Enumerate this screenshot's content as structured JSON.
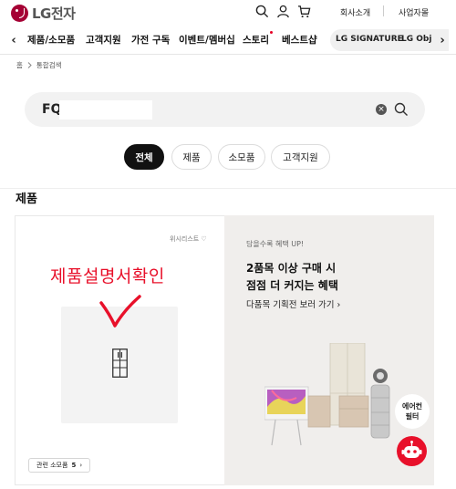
{
  "header": {
    "logo_text": "LG전자",
    "links": [
      "회사소개",
      "사업자몰"
    ]
  },
  "nav": {
    "prev_glyph": "‹",
    "next_glyph": "›",
    "items": [
      {
        "label": "제품/소모품"
      },
      {
        "label": "고객지원"
      },
      {
        "label": "가전 구독"
      },
      {
        "label": "이벤트/멤버십"
      },
      {
        "label": "스토리"
      },
      {
        "label": "베스트샵"
      }
    ],
    "pill_items": [
      "LG SIGNATURE",
      "LG Obj"
    ]
  },
  "breadcrumb": {
    "home": "홈",
    "current": "통합검색"
  },
  "search": {
    "value": "FQ",
    "clear_glyph": "×"
  },
  "tabs": [
    {
      "label": "전체",
      "active": true
    },
    {
      "label": "제품",
      "active": false
    },
    {
      "label": "소모품",
      "active": false
    },
    {
      "label": "고객지원",
      "active": false
    }
  ],
  "section_title": "제품",
  "product": {
    "wishlist_label": "위시리스트 ♡",
    "annotation": "제품설명서확인",
    "related_label": "관련 소모품",
    "related_count": "5",
    "related_arrow": "›"
  },
  "promo": {
    "label": "담을수록 혜택 UP!",
    "title_line1": "2품목 이상 구매 시",
    "title_line2": "점점 더 커지는 혜택",
    "link": "다품목 기획전 보러 가기 ›"
  },
  "floating": {
    "chip_line1": "에어컨",
    "chip_line2": "필터"
  },
  "colors": {
    "brand": "#a50034",
    "accent_red": "#e8102a",
    "active_tab": "#111111"
  }
}
